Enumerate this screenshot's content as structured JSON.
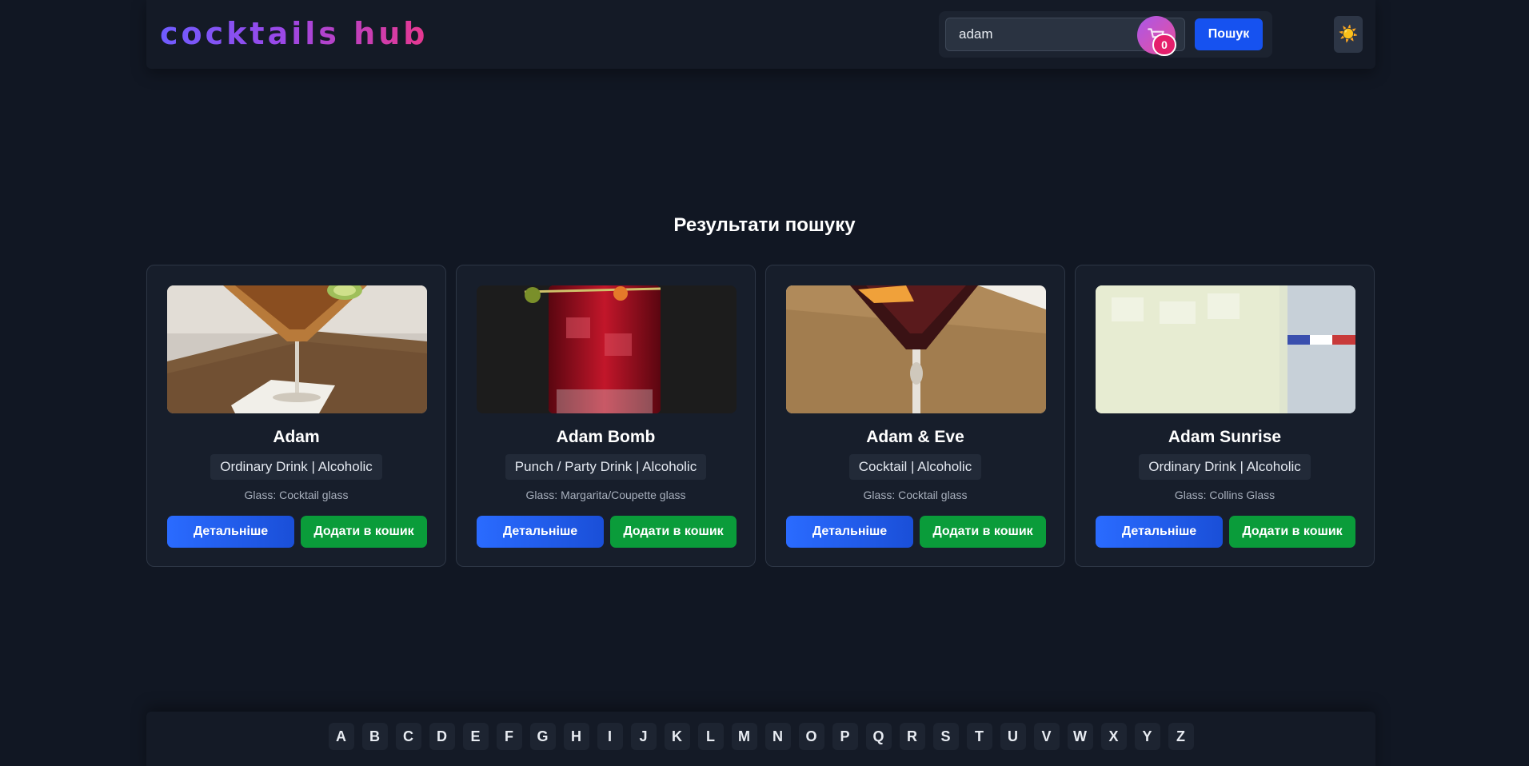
{
  "header": {
    "logo": "cocktails hub",
    "search": {
      "value": "adam",
      "button_label": "Пошук"
    },
    "cart_count": "0",
    "theme_icon": "☀️"
  },
  "results": {
    "title": "Результати пошуку",
    "cards": [
      {
        "name": "Adam",
        "tags": "Ordinary Drink | Alcoholic",
        "glass": "Glass: Cocktail glass",
        "details_label": "Детальніше",
        "add_label": "Додати в кошик"
      },
      {
        "name": "Adam Bomb",
        "tags": "Punch / Party Drink | Alcoholic",
        "glass": "Glass: Margarita/Coupette glass",
        "details_label": "Детальніше",
        "add_label": "Додати в кошик"
      },
      {
        "name": "Adam & Eve",
        "tags": "Cocktail | Alcoholic",
        "glass": "Glass: Cocktail glass",
        "details_label": "Детальніше",
        "add_label": "Додати в кошик"
      },
      {
        "name": "Adam Sunrise",
        "tags": "Ordinary Drink | Alcoholic",
        "glass": "Glass: Collins Glass",
        "details_label": "Детальніше",
        "add_label": "Додати в кошик"
      }
    ]
  },
  "alphabet": [
    "A",
    "B",
    "C",
    "D",
    "E",
    "F",
    "G",
    "H",
    "I",
    "J",
    "K",
    "L",
    "M",
    "N",
    "O",
    "P",
    "Q",
    "R",
    "S",
    "T",
    "U",
    "V",
    "W",
    "X",
    "Y",
    "Z"
  ],
  "colors": {
    "background": "#111723",
    "primary_button": "#1652f0",
    "add_button": "#0a9c3a",
    "badge": "#e51f6c"
  }
}
